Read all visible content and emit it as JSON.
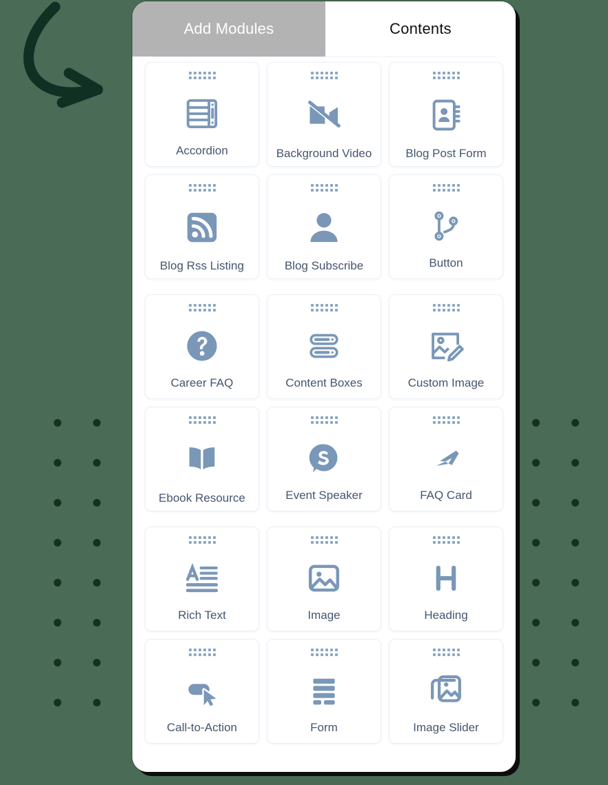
{
  "theme": {
    "background_green": "#4a6b55",
    "dot_dark_green": "#16311f",
    "arrow_green": "#103024",
    "panel_white": "#ffffff",
    "active_tab_grey": "#b3b3b3",
    "icon_blue": "#7a97b8",
    "label_slate": "#45566e",
    "card_border": "#eaeff5"
  },
  "panel": {
    "tabs": [
      {
        "label": "Add Modules",
        "active": true,
        "name": "tab-add-modules"
      },
      {
        "label": "Contents",
        "active": false,
        "name": "tab-contents"
      }
    ]
  },
  "modules": {
    "groups": [
      {
        "rows": [
          [
            {
              "label": "Accordion",
              "icon": "accordion-icon"
            },
            {
              "label": "Background Video",
              "icon": "video-off-icon"
            },
            {
              "label": "Blog Post Form",
              "icon": "contact-book-icon"
            }
          ],
          [
            {
              "label": "Blog Rss Listing",
              "icon": "rss-feed-icon"
            },
            {
              "label": "Blog Subscribe",
              "icon": "user-icon"
            },
            {
              "label": "Button",
              "icon": "branch-node-icon"
            }
          ]
        ]
      },
      {
        "rows": [
          [
            {
              "label": "Career FAQ",
              "icon": "question-circle-icon"
            },
            {
              "label": "Content Boxes",
              "icon": "stacked-bars-icon"
            },
            {
              "label": "Custom Image",
              "icon": "image-edit-icon"
            }
          ],
          [
            {
              "label": "Ebook Resource",
              "icon": "open-book-icon"
            },
            {
              "label": "Event Speaker",
              "icon": "speaker-s-badge-icon"
            },
            {
              "label": "FAQ Card",
              "icon": "faq-arrow-icon"
            }
          ]
        ]
      },
      {
        "rows": [
          [
            {
              "label": "Rich Text",
              "icon": "rich-text-icon"
            },
            {
              "label": "Image",
              "icon": "image-icon"
            },
            {
              "label": "Heading",
              "icon": "heading-h-icon"
            }
          ],
          [
            {
              "label": "Call-to-Action",
              "icon": "cta-cursor-icon"
            },
            {
              "label": "Form",
              "icon": "form-rows-icon"
            },
            {
              "label": "Image Slider",
              "icon": "image-slider-icon"
            }
          ]
        ]
      }
    ]
  },
  "decoration": {
    "arrow": {
      "name": "curved-pointer-arrow",
      "direction": "down-right"
    },
    "dot_grids": [
      {
        "name": "dot-grid-left",
        "columns": 2,
        "rows": 8
      },
      {
        "name": "dot-grid-right",
        "columns": 2,
        "rows": 8
      }
    ]
  }
}
